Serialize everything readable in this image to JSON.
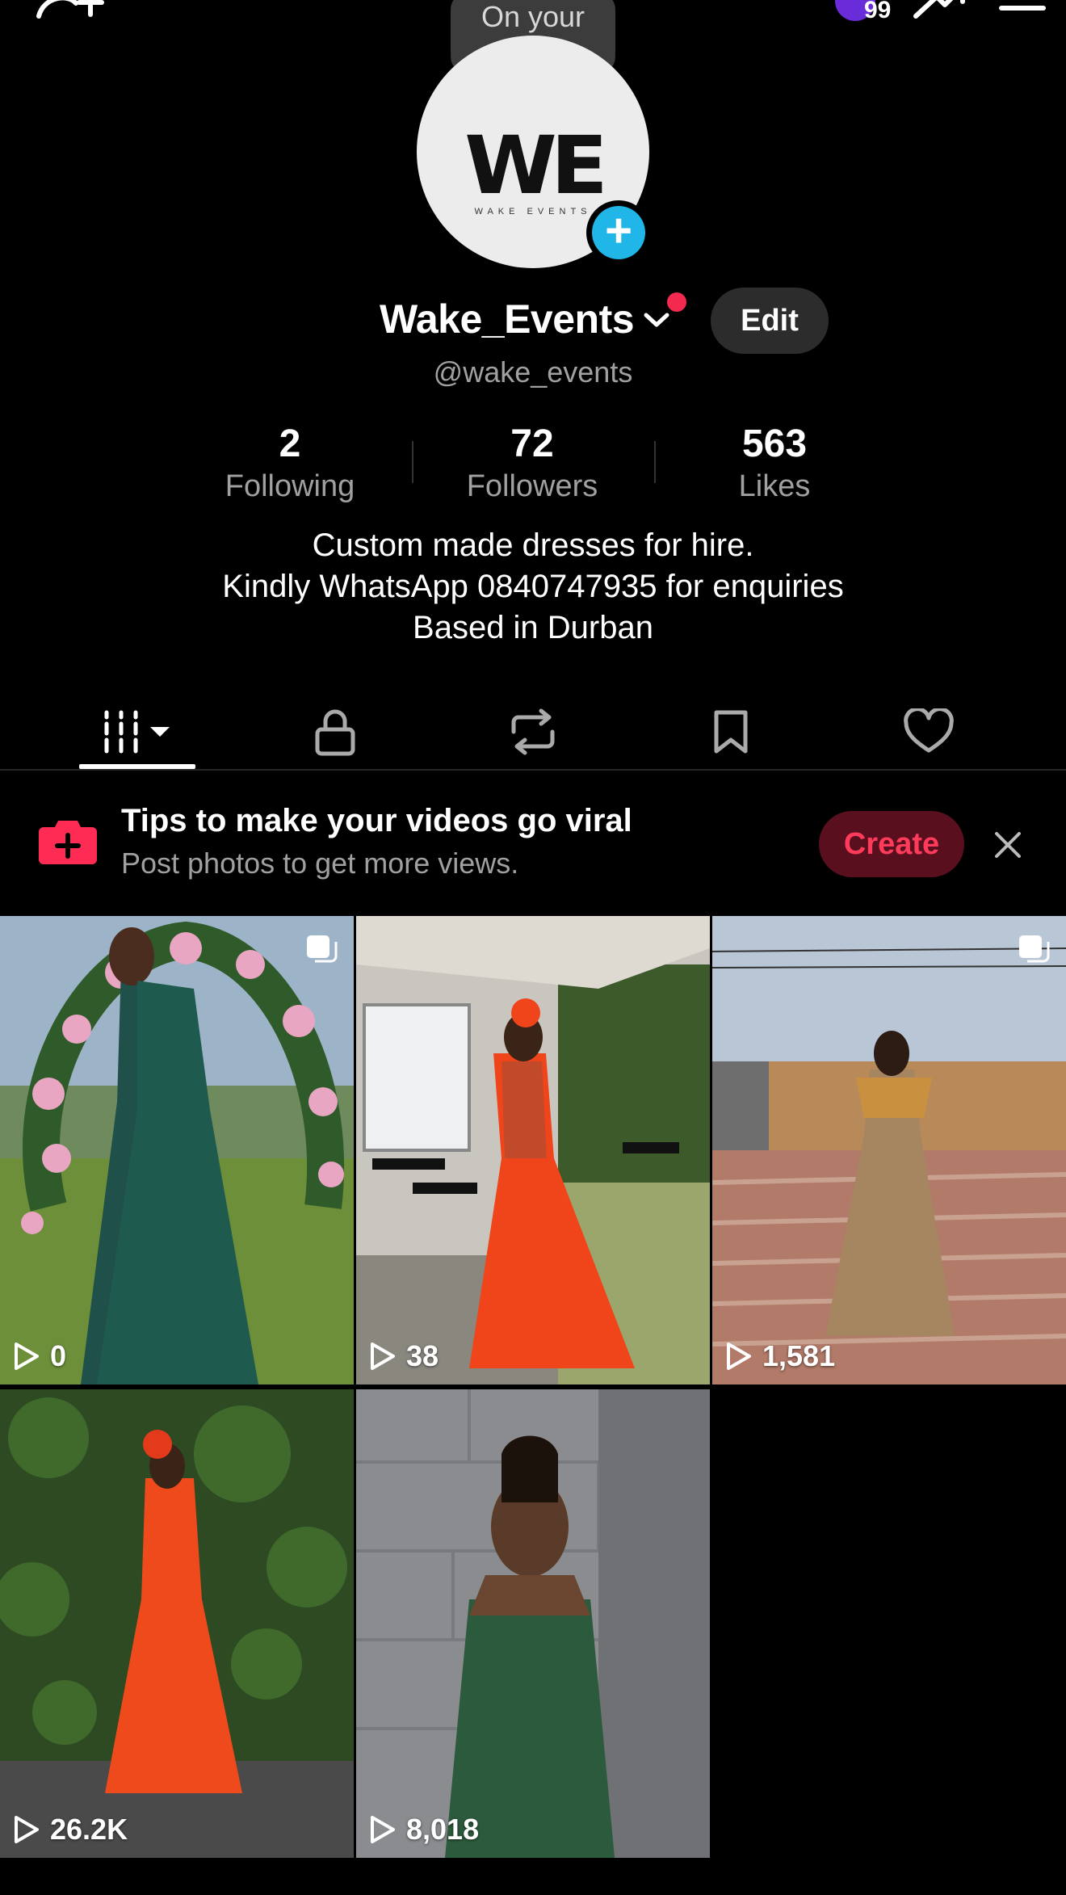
{
  "header": {
    "add_friend_icon": "person-add-icon",
    "badge_count": "99",
    "share_icon": "share-icon",
    "menu_icon": "menu-icon"
  },
  "profile": {
    "bubble_text": "On your mind...",
    "avatar_logo": "WE",
    "avatar_logo_sub": "WAKE EVENTS",
    "username": "Wake_Events",
    "handle": "@wake_events",
    "edit_label": "Edit",
    "stats": [
      {
        "number": "2",
        "label": "Following"
      },
      {
        "number": "72",
        "label": "Followers"
      },
      {
        "number": "563",
        "label": "Likes"
      }
    ],
    "bio": [
      "Custom made dresses for hire.",
      "Kindly WhatsApp 0840747935 for enquiries",
      "Based in Durban"
    ]
  },
  "tabs": [
    {
      "name": "videos",
      "icon": "grid-icon",
      "active": true
    },
    {
      "name": "private",
      "icon": "lock-icon",
      "active": false
    },
    {
      "name": "reposts",
      "icon": "repost-icon",
      "active": false
    },
    {
      "name": "favorites",
      "icon": "bookmark-icon",
      "active": false
    },
    {
      "name": "liked",
      "icon": "heart-icon",
      "active": false
    }
  ],
  "tips": {
    "title": "Tips to make your videos go viral",
    "subtitle": "Post photos to get more views.",
    "create_label": "Create"
  },
  "videos": [
    {
      "views": "0"
    },
    {
      "views": "38"
    },
    {
      "views": "1,581"
    },
    {
      "views": "26.2K"
    },
    {
      "views": "8,018"
    }
  ],
  "colors": {
    "accent_red": "#fe2c55",
    "accent_blue": "#20b7e8",
    "background": "#000000"
  }
}
